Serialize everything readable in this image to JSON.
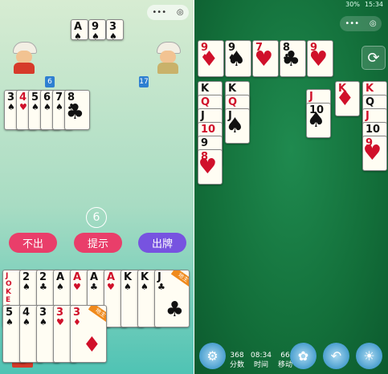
{
  "left": {
    "capsule": {
      "dots": "•••",
      "target": "◎"
    },
    "top_cards": [
      {
        "rank": "A",
        "suit": "♠"
      },
      {
        "rank": "9",
        "suit": "♠"
      },
      {
        "rank": "3",
        "suit": "♠"
      }
    ],
    "opponent_left": {
      "count": "6"
    },
    "opponent_right": {
      "count": "17"
    },
    "played_cards": [
      {
        "rank": "3",
        "suit": "♠",
        "color": "blk"
      },
      {
        "rank": "4",
        "suit": "♥",
        "color": "red"
      },
      {
        "rank": "5",
        "suit": "♠",
        "color": "blk"
      },
      {
        "rank": "6",
        "suit": "♠",
        "color": "blk"
      },
      {
        "rank": "7",
        "suit": "♠",
        "color": "blk"
      },
      {
        "rank": "8",
        "suit": "♣",
        "color": "blk"
      }
    ],
    "timer": "6",
    "buttons": {
      "pass": "不出",
      "hint": "提示",
      "play": "出牌"
    },
    "hand_row1": [
      {
        "rank": "JOKER",
        "color": "red",
        "joker": true
      },
      {
        "rank": "2",
        "suit": "♠",
        "color": "blk"
      },
      {
        "rank": "2",
        "suit": "♣",
        "color": "blk"
      },
      {
        "rank": "A",
        "suit": "♠",
        "color": "blk"
      },
      {
        "rank": "A",
        "suit": "♥",
        "color": "red"
      },
      {
        "rank": "A",
        "suit": "♣",
        "color": "blk"
      },
      {
        "rank": "A",
        "suit": "♥",
        "color": "red"
      },
      {
        "rank": "K",
        "suit": "♠",
        "color": "blk"
      },
      {
        "rank": "K",
        "suit": "♠",
        "color": "blk"
      },
      {
        "rank": "J",
        "suit": "♣",
        "color": "blk",
        "landlord": true
      }
    ],
    "hand_row2": [
      {
        "rank": "5",
        "suit": "♠",
        "color": "blk"
      },
      {
        "rank": "4",
        "suit": "♠",
        "color": "blk"
      },
      {
        "rank": "3",
        "suit": "♠",
        "color": "blk"
      },
      {
        "rank": "3",
        "suit": "♥",
        "color": "red"
      },
      {
        "rank": "3",
        "suit": "♦",
        "color": "red",
        "landlord": true
      }
    ],
    "landlord_badge": "地主"
  },
  "right": {
    "status": {
      "battery": "30%",
      "time": "15:34"
    },
    "capsule": {
      "dots": "•••",
      "target": "◎"
    },
    "foundation": [
      {
        "rank": "9",
        "suit": "♦",
        "color": "red"
      },
      {
        "rank": "9",
        "suit": "♠",
        "color": "blk"
      },
      {
        "rank": "7",
        "suit": "♥",
        "color": "red"
      },
      {
        "rank": "8",
        "suit": "♣",
        "color": "blk"
      },
      {
        "rank": "9",
        "suit": "♥",
        "color": "red"
      }
    ],
    "refresh_icon": "⟳",
    "col1": [
      {
        "rank": "K",
        "suit": "♠",
        "color": "blk"
      },
      {
        "rank": "Q",
        "suit": "♥",
        "color": "red"
      },
      {
        "rank": "J",
        "suit": "♠",
        "color": "blk"
      },
      {
        "rank": "10",
        "suit": "♦",
        "color": "red"
      },
      {
        "rank": "9",
        "suit": "♠",
        "color": "blk"
      },
      {
        "rank": "8",
        "suit": "♥",
        "color": "red"
      }
    ],
    "col2": [
      {
        "rank": "K",
        "suit": "♠",
        "color": "blk"
      },
      {
        "rank": "Q",
        "suit": "♥",
        "color": "red"
      },
      {
        "rank": "J",
        "suit": "♠",
        "color": "blk"
      }
    ],
    "col3": [
      {
        "rank": "J",
        "suit": "♦",
        "color": "red"
      },
      {
        "rank": "10",
        "suit": "♠",
        "color": "blk"
      }
    ],
    "col4": [
      {
        "rank": "K",
        "suit": "♦",
        "color": "red"
      }
    ],
    "col5": [
      {
        "rank": "K",
        "suit": "♥",
        "color": "red"
      },
      {
        "rank": "Q",
        "suit": "♠",
        "color": "blk"
      },
      {
        "rank": "J",
        "suit": "♦",
        "color": "red"
      },
      {
        "rank": "10",
        "suit": "♠",
        "color": "blk"
      },
      {
        "rank": "9",
        "suit": "♥",
        "color": "red"
      }
    ],
    "stats": [
      {
        "value": "368",
        "label": "分数"
      },
      {
        "value": "08:34",
        "label": "时间"
      },
      {
        "value": "66",
        "label": "移动"
      }
    ],
    "icons": {
      "settings": "settings-icon",
      "gift": "gift-icon",
      "undo": "undo-icon",
      "hint": "lightbulb-icon"
    }
  }
}
